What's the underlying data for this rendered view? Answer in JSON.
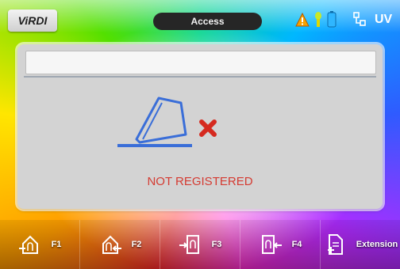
{
  "header": {
    "logo_text": "ViRDI",
    "title": "Access",
    "status_icons": [
      "warning-icon",
      "bulb-icon",
      "battery-icon",
      "network-icon",
      "uv-icon"
    ],
    "uv_label": "UV"
  },
  "main": {
    "input_value": "",
    "message": "NOT REGISTERED",
    "message_color": "#d43b32"
  },
  "function_keys": [
    {
      "label": "F1",
      "icon": "fingerprint-in-icon"
    },
    {
      "label": "F2",
      "icon": "fingerprint-out-icon"
    },
    {
      "label": "F3",
      "icon": "door-in-icon"
    },
    {
      "label": "F4",
      "icon": "door-out-icon"
    },
    {
      "label": "Extension",
      "icon": "extension-icon"
    }
  ]
}
